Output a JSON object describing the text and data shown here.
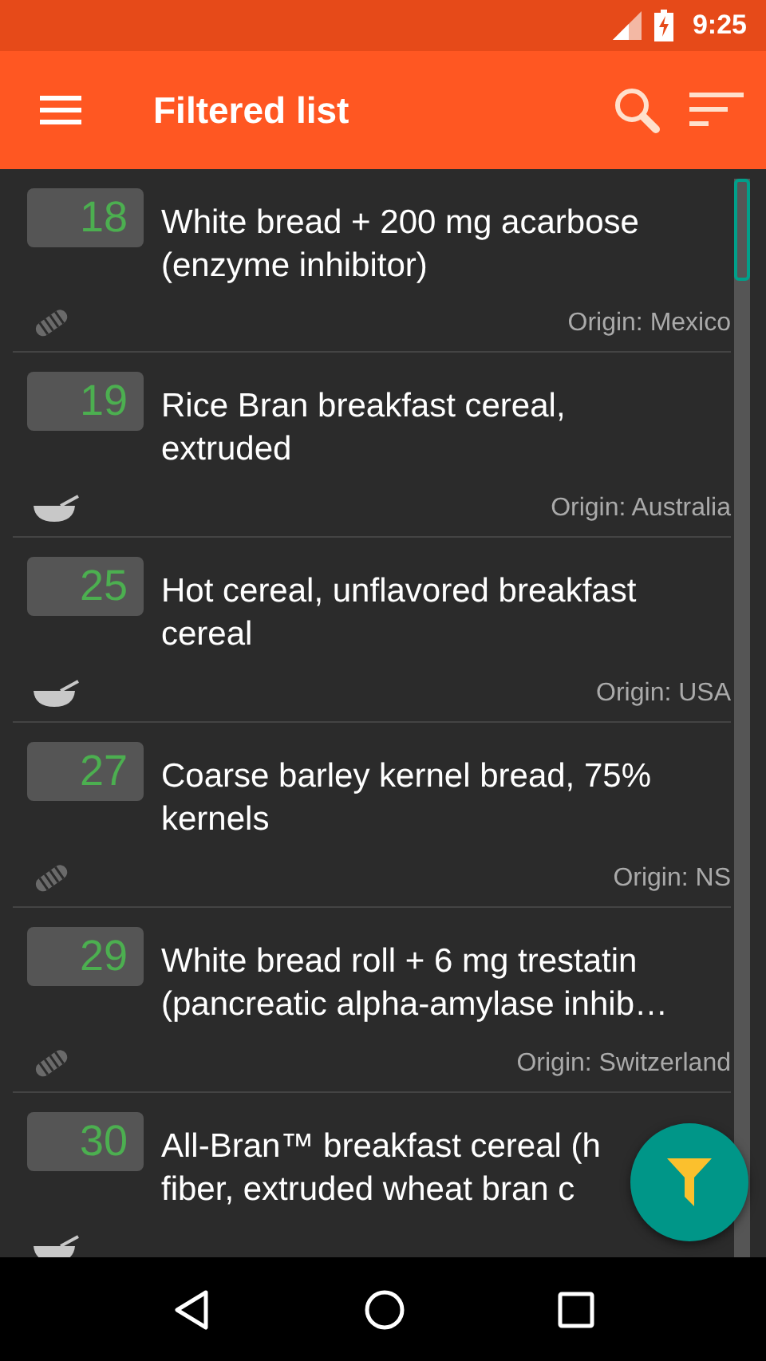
{
  "status_bar": {
    "time": "9:25"
  },
  "toolbar": {
    "title": "Filtered list"
  },
  "items": [
    {
      "score": "18",
      "title": "White bread + 200 mg acarbose (enzyme inhibitor)",
      "origin": "Origin: Mexico",
      "kind": "bread"
    },
    {
      "score": "19",
      "title": "Rice Bran breakfast cereal, extruded",
      "origin": "Origin: Australia",
      "kind": "cereal"
    },
    {
      "score": "25",
      "title": "Hot cereal, unflavored breakfast cereal",
      "origin": "Origin: USA",
      "kind": "cereal"
    },
    {
      "score": "27",
      "title": "Coarse barley kernel bread, 75% kernels",
      "origin": "Origin: NS",
      "kind": "bread"
    },
    {
      "score": "29",
      "title": "White bread roll + 6 mg trestatin (pancreatic alpha-amylase inhib…",
      "origin": "Origin: Switzerland",
      "kind": "bread"
    },
    {
      "score": "30",
      "title": "All-Bran™ breakfast cereal (h\nfiber, extruded wheat bran c",
      "kind": "cereal"
    }
  ]
}
